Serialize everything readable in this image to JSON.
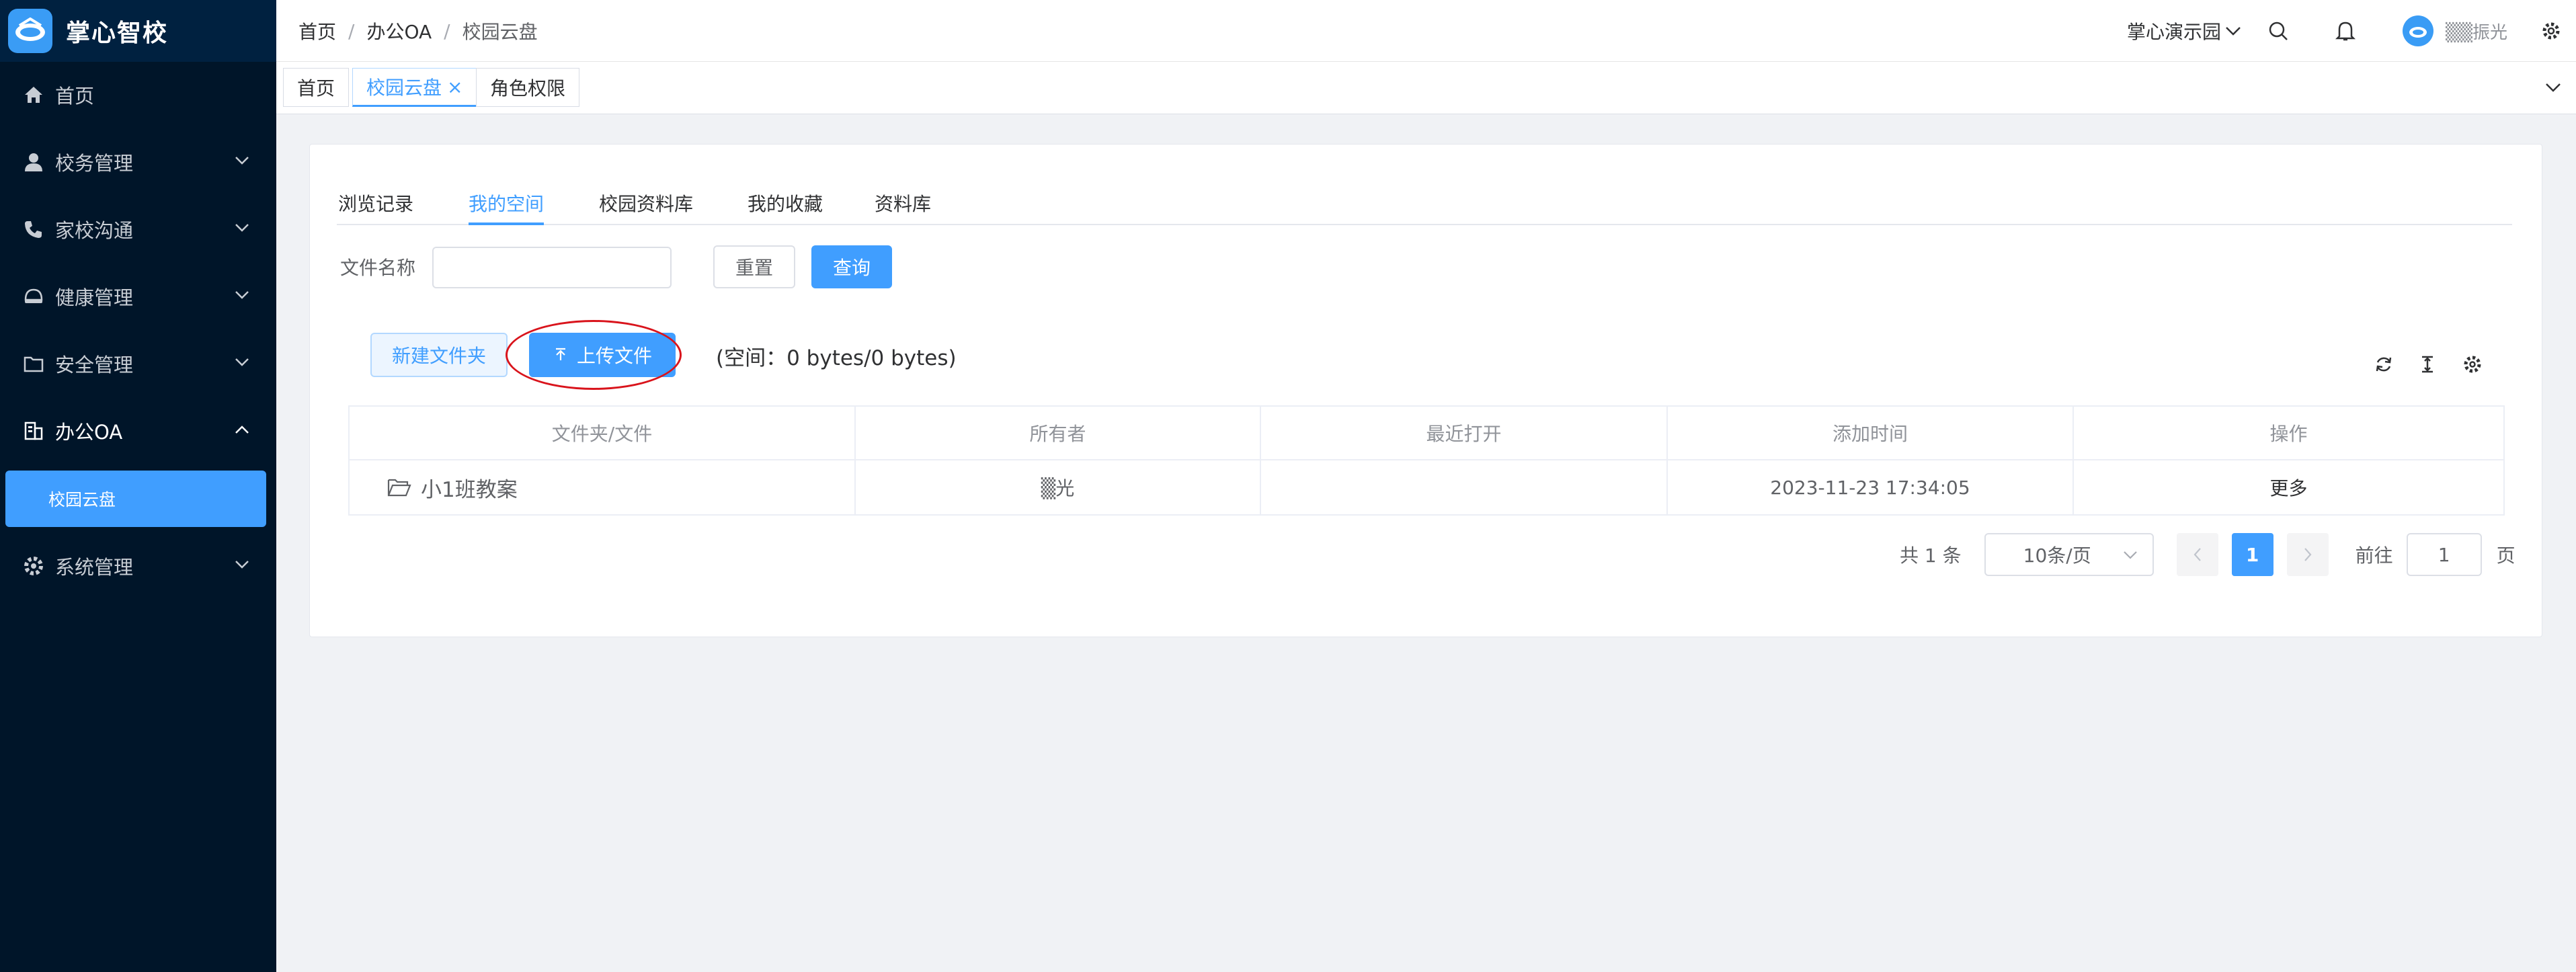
{
  "app": {
    "title": "掌心智校"
  },
  "sidebar": {
    "items": [
      {
        "label": "首页",
        "icon": "home-icon"
      },
      {
        "label": "校务管理",
        "icon": "user-icon"
      },
      {
        "label": "家校沟通",
        "icon": "phone-icon"
      },
      {
        "label": "健康管理",
        "icon": "heart-icon"
      },
      {
        "label": "安全管理",
        "icon": "folder-icon"
      },
      {
        "label": "办公OA",
        "icon": "building-icon"
      },
      {
        "label": "系统管理",
        "icon": "gear-icon"
      }
    ],
    "sub_item": "校园云盘"
  },
  "breadcrumb": {
    "items": [
      "首页",
      "办公OA",
      "校园云盘"
    ],
    "separator": "/"
  },
  "header": {
    "school": "掌心演示园",
    "user": "▒▒振光"
  },
  "tags": [
    {
      "label": "首页"
    },
    {
      "label": "校园云盘",
      "close": "×"
    },
    {
      "label": "角色权限"
    }
  ],
  "tabs": [
    "浏览记录",
    "我的空间",
    "校园资料库",
    "我的收藏",
    "资料库"
  ],
  "search": {
    "label": "文件名称",
    "value": "",
    "reset": "重置",
    "query": "查询"
  },
  "actions": {
    "new_folder": "新建文件夹",
    "upload": "上传文件",
    "space": "(空间：0 bytes/0 bytes)"
  },
  "table": {
    "headers": [
      "文件夹/文件",
      "所有者",
      "最近打开",
      "添加时间",
      "操作"
    ],
    "rows": [
      {
        "name": "小1班教案",
        "owner": "▒光",
        "last_open": "",
        "added": "2023-11-23 17:34:05",
        "op": "更多"
      }
    ]
  },
  "pagination": {
    "total": "共 1 条",
    "page_size": "10条/页",
    "current": "1",
    "goto_label": "前往",
    "goto_value": "1",
    "page_suffix": "页"
  },
  "colors": {
    "primary": "#409eff",
    "sidebar": "#001529",
    "annotation": "#d9141c"
  }
}
